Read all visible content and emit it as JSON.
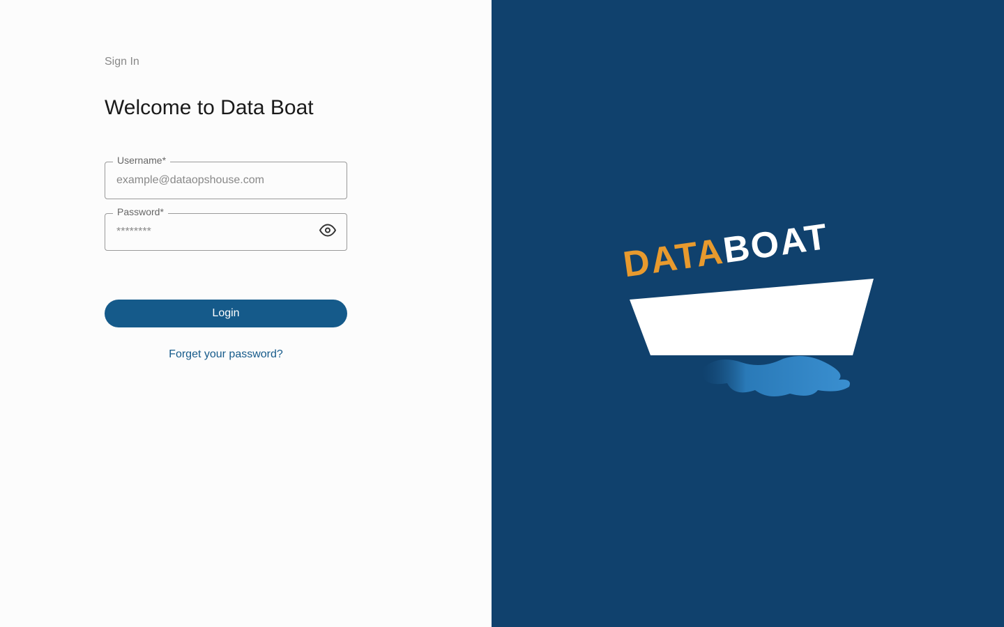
{
  "header": {
    "sign_in_label": "Sign In",
    "welcome_title": "Welcome to Data Boat"
  },
  "form": {
    "username_label": "Username*",
    "username_placeholder": "example@dataopshouse.com",
    "password_label": "Password*",
    "password_placeholder": "********",
    "login_button": "Login",
    "forgot_password": "Forget your password?"
  },
  "logo": {
    "text_data": "DATA",
    "text_boat": "BOAT"
  },
  "colors": {
    "brand_blue": "#10416d",
    "brand_orange": "#e89a2e",
    "button_blue": "#155a8a"
  }
}
